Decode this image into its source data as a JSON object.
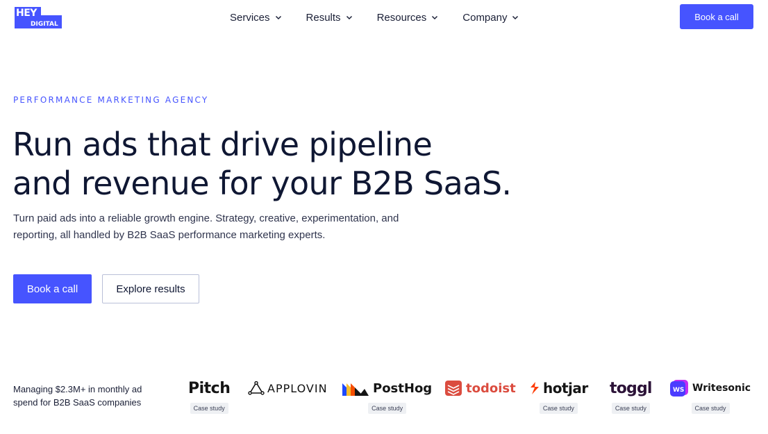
{
  "header": {
    "logo": {
      "top": "HEY",
      "bottom": "DIGITAL"
    },
    "nav": [
      {
        "label": "Services"
      },
      {
        "label": "Results"
      },
      {
        "label": "Resources"
      },
      {
        "label": "Company"
      }
    ],
    "cta_label": "Book a call"
  },
  "hero": {
    "eyebrow": "PERFORMANCE MARKETING AGENCY",
    "headline_line1": "Run ads that drive pipeline",
    "headline_line2": "and revenue for your B2B SaaS.",
    "subtext": "Turn paid ads into a reliable growth engine. Strategy, creative, experimentation, and reporting, all handled by B2B SaaS performance marketing experts.",
    "primary_button": "Book a call",
    "secondary_button": "Explore results"
  },
  "clients": {
    "intro": "Managing $2.3M+ in monthly ad spend for B2B SaaS companies",
    "badge_label": "Case study",
    "brands": [
      {
        "name": "Pitch",
        "case_study": true
      },
      {
        "name": "APPLOVIN",
        "case_study": false
      },
      {
        "name": "PostHog",
        "case_study": true
      },
      {
        "name": "todoist",
        "case_study": false
      },
      {
        "name": "hotjar",
        "case_study": true
      },
      {
        "name": "toggl",
        "case_study": true
      },
      {
        "name": "Writesonic",
        "case_study": true
      }
    ]
  },
  "colors": {
    "accent": "#4654ff",
    "text_dark": "#0f1733",
    "todoist_red": "#db4c3f",
    "hotjar_orange": "#fd3a00",
    "toggl_purple": "#2c1338"
  }
}
